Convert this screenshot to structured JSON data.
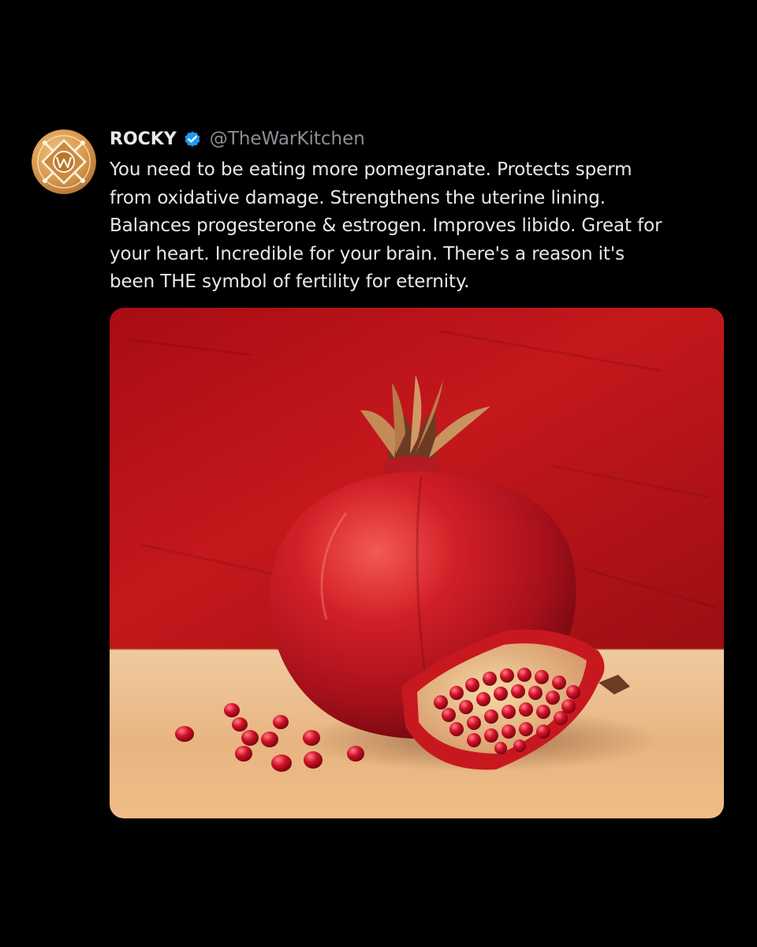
{
  "tweet": {
    "author": {
      "display_name": "ROCKY",
      "handle": "@TheWarKitchen",
      "verified": true,
      "avatar_icon": "war-kitchen-logo-icon",
      "verified_icon": "verified-badge-icon"
    },
    "text_lines": [
      "You need to be eating more pomegranate. Protects sperm",
      "from oxidative damage. Strengthens the uterine lining.",
      "Balances progesterone & estrogen. Improves libido. Great for",
      "your heart. Incredible for your brain. There's a reason it's",
      "been THE symbol of fertility for eternity."
    ],
    "media": {
      "type": "painting",
      "subject_icon": "pomegranate-painting-icon"
    }
  },
  "colors": {
    "background": "#000000",
    "text": "#e7e9ea",
    "handle": "#8b9096",
    "verified_badge": "#1d9bf0",
    "avatar_gold": "#d89a4e",
    "painting_red": "#b8141a",
    "painting_table": "#e7b78a"
  }
}
